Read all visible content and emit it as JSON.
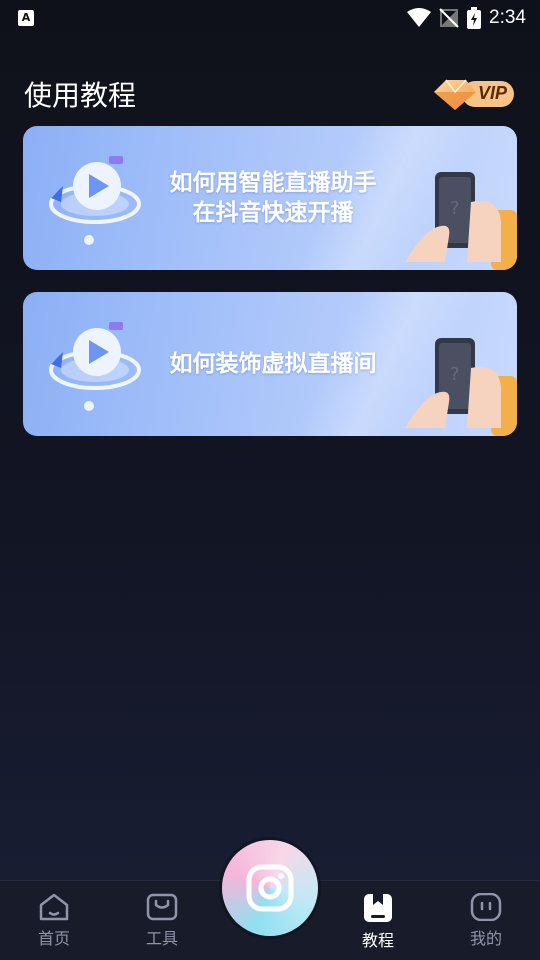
{
  "status_bar": {
    "app_badge": "A",
    "time": "2:34"
  },
  "header": {
    "title": "使用教程",
    "vip_label": "VIP"
  },
  "cards": [
    {
      "title_line1": "如何用智能直播助手",
      "title_line2": "在抖音快速开播"
    },
    {
      "title_line1": "如何装饰虚拟直播间"
    }
  ],
  "nav": {
    "items": [
      {
        "label": "首页",
        "icon": "home-icon"
      },
      {
        "label": "工具",
        "icon": "toolbox-icon"
      },
      {
        "label": "教程",
        "icon": "tutorial-book-icon",
        "active": true
      },
      {
        "label": "我的",
        "icon": "profile-face-icon"
      }
    ],
    "center_icon": "camera-icon"
  },
  "colors": {
    "background": "#0f111a",
    "card_gradient_start": "#8cb0f6",
    "card_gradient_end": "#c8d9fd",
    "vip_gold": "#f0a14b",
    "nav_inactive": "#8f94a8",
    "nav_active": "#ffffff"
  }
}
